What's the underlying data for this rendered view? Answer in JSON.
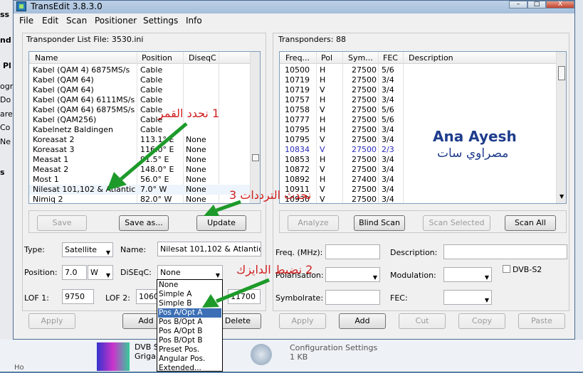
{
  "window": {
    "title": "TransEdit 3.8.3.0",
    "controls": {
      "minimize": "–",
      "maximize": "□",
      "close": "X"
    }
  },
  "menu": [
    "File",
    "Edit",
    "Scan",
    "Positioner",
    "Settings",
    "Info"
  ],
  "left_panel": {
    "header": "Transponder List File:  3530.ini",
    "columns": [
      "Name",
      "Position",
      "DiseqC"
    ],
    "rows": [
      {
        "name": "Kabel (QAM 4) 6875MS/s",
        "position": "Cable",
        "diseqc": ""
      },
      {
        "name": "Kabel (QAM 64)",
        "position": "Cable",
        "diseqc": ""
      },
      {
        "name": "Kabel (QAM 64)",
        "position": "Cable",
        "diseqc": ""
      },
      {
        "name": "Kabel (QAM 64) 6111MS/s",
        "position": "Cable",
        "diseqc": ""
      },
      {
        "name": "Kabel (QAM 64) 6875MS/s",
        "position": "Cable",
        "diseqc": ""
      },
      {
        "name": "Kabel (QAM256)",
        "position": "Cable",
        "diseqc": ""
      },
      {
        "name": "Kabelnetz Baldingen",
        "position": "Cable",
        "diseqc": ""
      },
      {
        "name": "Koreasat 2",
        "position": "113.1° E",
        "diseqc": "None"
      },
      {
        "name": "Koreasat 3",
        "position": "116.0° E",
        "diseqc": "None"
      },
      {
        "name": "Measat 1",
        "position": "91.5° E",
        "diseqc": "None"
      },
      {
        "name": "Measat 2",
        "position": "148.0° E",
        "diseqc": "None"
      },
      {
        "name": "Most 1",
        "position": "56.0° E",
        "diseqc": "None"
      },
      {
        "name": "Nilesat 101,102 & Atlantic ...",
        "position": "7.0° W",
        "diseqc": "None"
      },
      {
        "name": "Nimiq 2",
        "position": "82.0° W",
        "diseqc": "None"
      }
    ],
    "buttons": {
      "save": "Save",
      "save_as": "Save as...",
      "update": "Update"
    },
    "form": {
      "type_label": "Type:",
      "type_value": "Satellite",
      "name_label": "Name:",
      "name_value": "Nilesat 101,102 & Atlantic Bird",
      "position_label": "Position:",
      "position_value": "7.0",
      "position_dir": "W",
      "diseqc_label": "DiSEqC:",
      "diseqc_value": "None",
      "lof1_label": "LOF 1:",
      "lof1_value": "9750",
      "lof2_label": "LOF 2:",
      "lof2_value": "1060",
      "lof3_value": "11700"
    },
    "bottom_buttons": {
      "apply": "Apply",
      "add": "Add",
      "delete": "Delete"
    },
    "diseqc_options": [
      "None",
      "Simple A",
      "Simple B",
      "Pos A/Opt A",
      "Pos B/Opt A",
      "Pos A/Opt B",
      "Pos B/Opt B",
      "Preset Pos.",
      "Angular Pos.",
      "Extended..."
    ],
    "diseqc_selected": "Pos A/Opt A"
  },
  "right_panel": {
    "header": "Transponders: 88",
    "columns": [
      "Freq...",
      "Pol",
      "Sym...",
      "FEC",
      "Description"
    ],
    "rows": [
      {
        "freq": "10500",
        "pol": "H",
        "sym": "27500",
        "fec": "5/6"
      },
      {
        "freq": "10719",
        "pol": "H",
        "sym": "27500",
        "fec": "3/4"
      },
      {
        "freq": "10719",
        "pol": "V",
        "sym": "27500",
        "fec": "3/4"
      },
      {
        "freq": "10757",
        "pol": "H",
        "sym": "27500",
        "fec": "3/4"
      },
      {
        "freq": "10758",
        "pol": "V",
        "sym": "27500",
        "fec": "5/6"
      },
      {
        "freq": "10777",
        "pol": "H",
        "sym": "27500",
        "fec": "5/6"
      },
      {
        "freq": "10795",
        "pol": "H",
        "sym": "27500",
        "fec": "3/4"
      },
      {
        "freq": "10795",
        "pol": "V",
        "sym": "27500",
        "fec": "3/4"
      },
      {
        "freq": "10834",
        "pol": "V",
        "sym": "27500",
        "fec": "2/3"
      },
      {
        "freq": "10853",
        "pol": "H",
        "sym": "27500",
        "fec": "3/4"
      },
      {
        "freq": "10872",
        "pol": "V",
        "sym": "27500",
        "fec": "3/4"
      },
      {
        "freq": "10892",
        "pol": "H",
        "sym": "27400",
        "fec": "3/4"
      },
      {
        "freq": "10911",
        "pol": "V",
        "sym": "27500",
        "fec": "3/4"
      },
      {
        "freq": "10930",
        "pol": "V",
        "sym": "27500",
        "fec": "3/4"
      }
    ],
    "highlight_color": "#2a2ab8",
    "buttons": {
      "analyze": "Analyze",
      "blind_scan": "Blind Scan",
      "scan_selected": "Scan Selected",
      "scan_all": "Scan All"
    },
    "form": {
      "freq_label": "Freq. (MHz):",
      "description_label": "Description:",
      "polarisation_label": "Polarisation:",
      "modulation_label": "Modulation:",
      "dvbs2_label": "DVB-S2",
      "symbolrate_label": "Symbolrate:",
      "fec_label": "FEC:"
    },
    "bottom_buttons": {
      "apply": "Apply",
      "add": "Add",
      "cut": "Cut",
      "copy": "Copy",
      "paste": "Paste"
    }
  },
  "annotations": {
    "step1": "1   نحدد القمر",
    "step2": "2   نضبط الدايزك",
    "step3": "نحدث الترددات  3",
    "watermark_en": "Ana Ayesh",
    "watermark_ar": "مصراوي سات"
  },
  "background": {
    "left_fragments": [
      "ss",
      "nd",
      "Pl",
      "ogr",
      "Do",
      "are",
      "Co",
      "Ne",
      "s"
    ],
    "taskbar_item1": "DVB Sc",
    "taskbar_item1b": "Griga",
    "taskbar_item2_title": "Configuration Settings",
    "taskbar_item2_size": "1 KB",
    "bottom_left": "Ho"
  }
}
